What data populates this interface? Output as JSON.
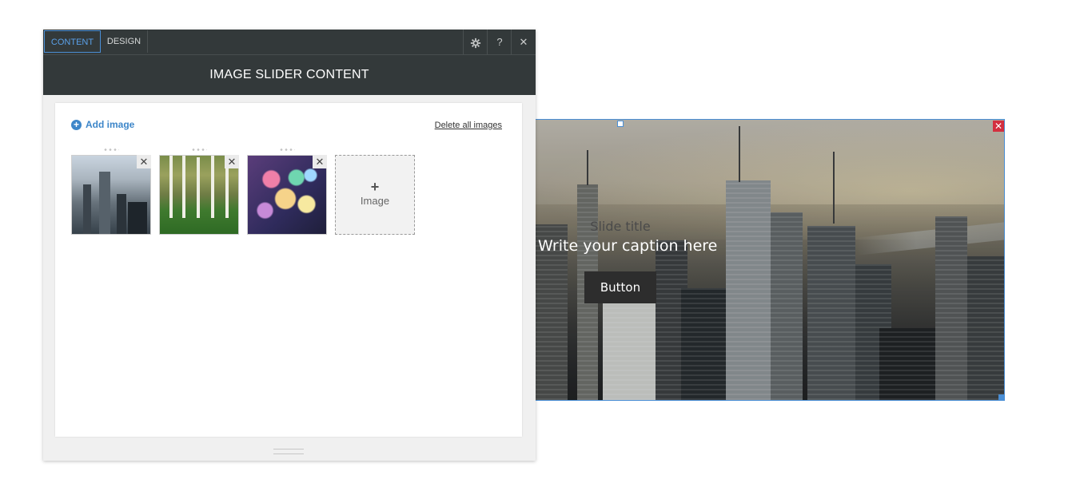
{
  "panel": {
    "tabs": [
      {
        "label": "CONTENT",
        "active": true
      },
      {
        "label": "DESIGN",
        "active": false
      }
    ],
    "tools": {
      "settings_icon": "gear-icon",
      "help_label": "?",
      "close_label": "✕"
    },
    "header_title": "IMAGE SLIDER CONTENT",
    "add_image": {
      "icon": "+",
      "label": "Add image"
    },
    "delete_all_label": "Delete all images",
    "thumbnails": [
      {
        "name": "city",
        "close": "✕"
      },
      {
        "name": "forest",
        "close": "✕"
      },
      {
        "name": "bokeh",
        "close": "✕"
      }
    ],
    "add_tile": {
      "plus": "+",
      "label": "Image"
    }
  },
  "slider": {
    "slide_title": "Slide title",
    "caption": "Write your caption here",
    "button_label": "Button",
    "close_label": "✕"
  },
  "colors": {
    "accent": "#4a8fd6",
    "dark_bar": "#33393a",
    "link_blue": "#3d86c9",
    "close_red": "#d32f3f"
  }
}
